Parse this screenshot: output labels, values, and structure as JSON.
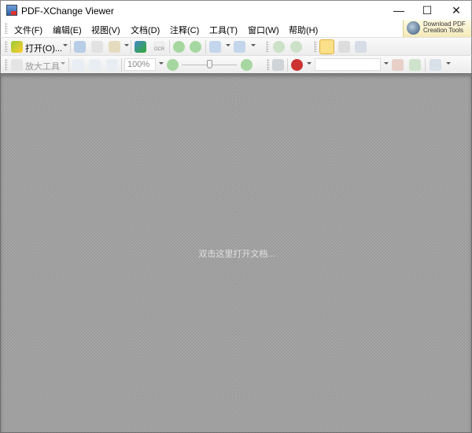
{
  "window": {
    "title": "PDF-XChange Viewer",
    "minimize": "—",
    "maximize": "☐",
    "close": "✕"
  },
  "menu": [
    "文件(F)",
    "编辑(E)",
    "视图(V)",
    "文档(D)",
    "注释(C)",
    "工具(T)",
    "窗口(W)",
    "帮助(H)"
  ],
  "promo": {
    "line1": "Download PDF",
    "line2": "Creation Tools"
  },
  "toolbar1": {
    "open_label": "打开(O)...",
    "ocr": "OCR"
  },
  "toolbar2": {
    "zoom_tool_label": "放大工具",
    "zoom_value": "100%",
    "search_value": ""
  },
  "workspace": {
    "hint": "双击这里打开文档..."
  },
  "colors": {
    "workspace": "#9c9c9c",
    "hand_active": "#fbe08a"
  }
}
